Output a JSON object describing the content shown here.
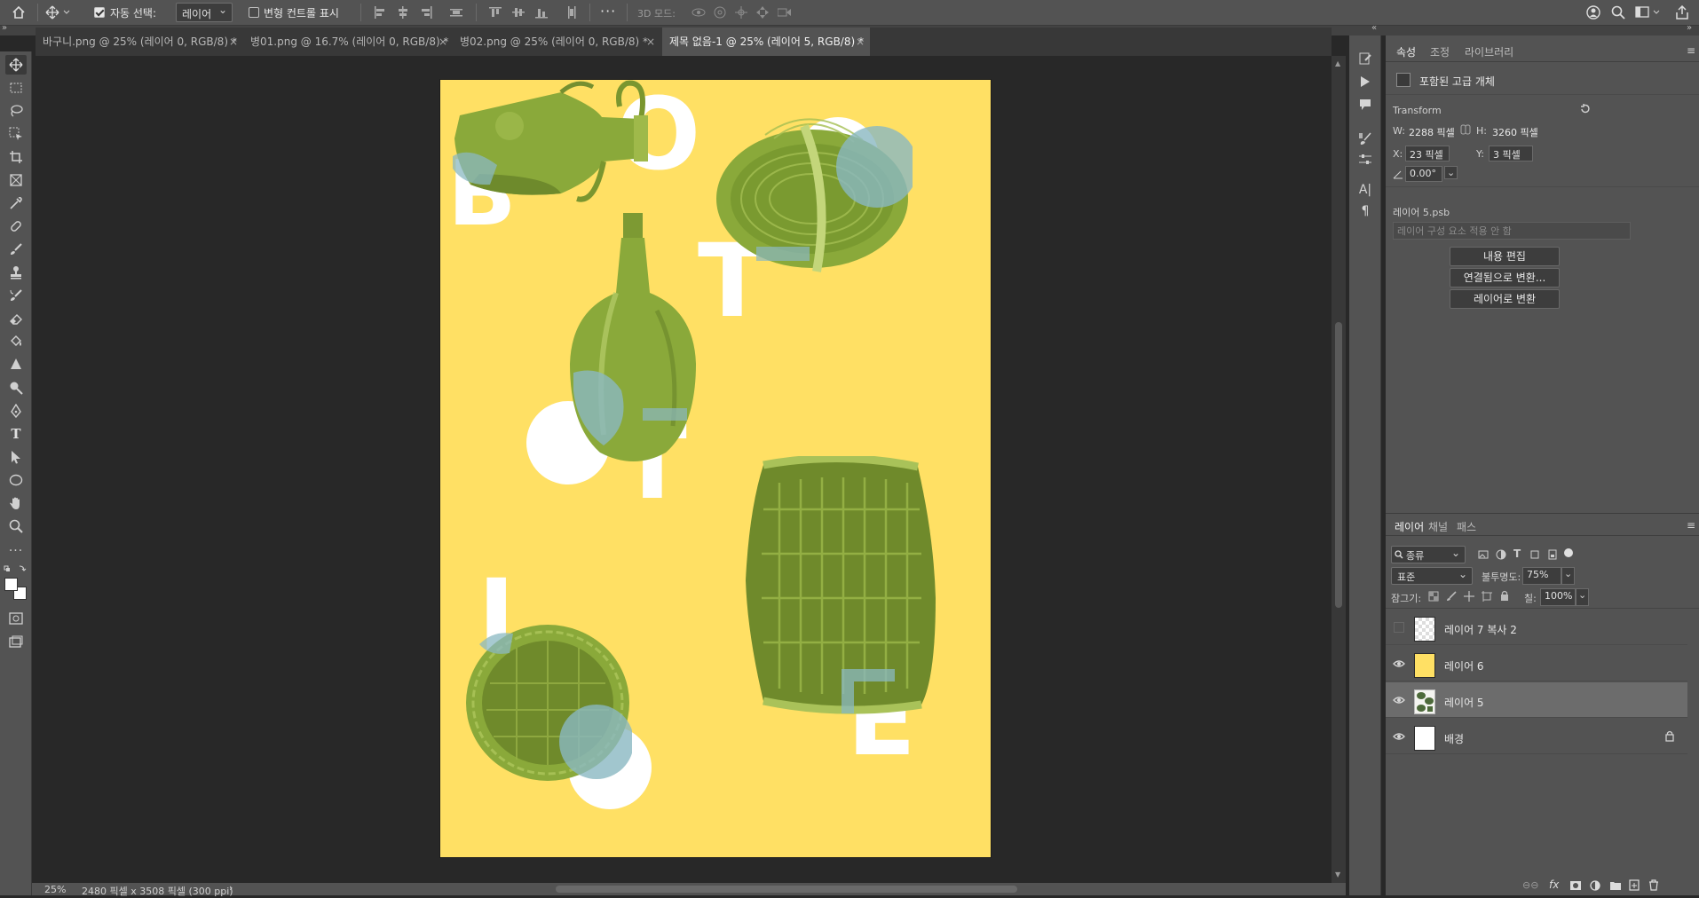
{
  "option_bar": {
    "auto_select_label": "자동 선택:",
    "auto_select_value": "레이어",
    "transform_controls_label": "변형 컨트롤 표시",
    "mode_3d_label": "3D 모드:",
    "more_icon": "···"
  },
  "tabs": [
    {
      "label": "바구니.png @ 25% (레이어 0, RGB/8) *",
      "active": false
    },
    {
      "label": "병01.png @ 16.7% (레이어 0, RGB/8) *",
      "active": false
    },
    {
      "label": "병02.png @ 25% (레이어 0, RGB/8) *",
      "active": false
    },
    {
      "label": "제목 없음-1 @ 25% (레이어 5, RGB/8) *",
      "active": true
    }
  ],
  "tab_close": "×",
  "document": {
    "background_color": "#ffe064",
    "letters": [
      "B",
      "O",
      "T",
      "O",
      "T",
      "L",
      "E",
      "O"
    ]
  },
  "status": {
    "zoom": "25%",
    "doc_size": "2480 픽셀 x 3508 픽셀 (300 ppi)",
    "arrow": "›"
  },
  "properties": {
    "tabs": [
      "속성",
      "조정",
      "라이브러리"
    ],
    "object_type": "포함된 고급 개체",
    "transform_title": "Transform",
    "w_label": "W:",
    "w_value": "2288 픽셀",
    "h_label": "H:",
    "h_value": "3260 픽셀",
    "x_label": "X:",
    "x_value": "23 픽셀",
    "y_label": "Y:",
    "y_value": "3 픽셀",
    "angle_value": "0.00°",
    "file_name": "레이어 5.psb",
    "comp_placeholder": "레이어 구성 요소 적용 안 함",
    "buttons": [
      "내용 편집",
      "연결됨으로 변환...",
      "레이어로 변환"
    ]
  },
  "layers_panel": {
    "tabs": [
      "레이어",
      "채널",
      "패스"
    ],
    "filter_label": "종류",
    "blend_mode": "표준",
    "opacity_label": "불투명도:",
    "opacity_value": "75%",
    "lock_label": "잠그기:",
    "fill_label": "칠:",
    "fill_value": "100%",
    "layers": [
      {
        "name": "레이어 7 복사 2",
        "visible": false,
        "selected": false,
        "locked": false
      },
      {
        "name": "레이어 6",
        "visible": true,
        "selected": false,
        "locked": false
      },
      {
        "name": "레이어 5",
        "visible": true,
        "selected": true,
        "locked": false
      },
      {
        "name": "배경",
        "visible": true,
        "selected": false,
        "locked": true
      }
    ]
  },
  "colors": {
    "panel": "#535353",
    "canvas_bg": "#282828",
    "doc_yellow": "#ffe064",
    "photo_olive": "#8aa93a",
    "blue_overlay": "#8ab8c2"
  }
}
